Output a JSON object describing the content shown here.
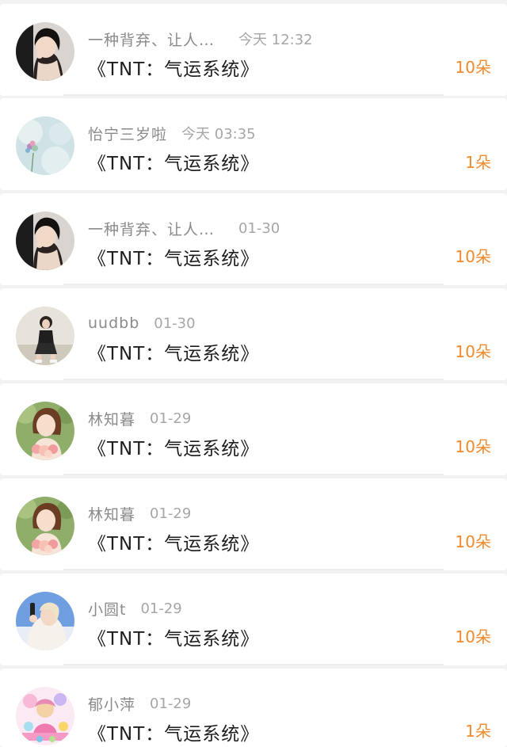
{
  "gifts": [
    {
      "name": "一种背弃、让人…",
      "time": "今天 12:32",
      "book": "《TNT：气运系统》",
      "count": "10朵",
      "avatar_icon": "girl-dark-hair-avatar"
    },
    {
      "name": "怡宁三岁啦",
      "time": "今天 03:35",
      "book": "《TNT：气运系统》",
      "count": "1朵",
      "avatar_icon": "flower-sky-avatar"
    },
    {
      "name": "一种背弃、让人…",
      "time": "01-30",
      "book": "《TNT：气运系统》",
      "count": "10朵",
      "avatar_icon": "girl-dark-hair-avatar"
    },
    {
      "name": "uudbb",
      "time": "01-30",
      "book": "《TNT：气运系统》",
      "count": "10朵",
      "avatar_icon": "sitting-girl-avatar"
    },
    {
      "name": "林知暮",
      "time": "01-29",
      "book": "《TNT：气运系统》",
      "count": "10朵",
      "avatar_icon": "girl-flowers-avatar"
    },
    {
      "name": "林知暮",
      "time": "01-29",
      "book": "《TNT：气运系统》",
      "count": "10朵",
      "avatar_icon": "girl-flowers-avatar"
    },
    {
      "name": "小圆t",
      "time": "01-29",
      "book": "《TNT：气运系统》",
      "count": "10朵",
      "avatar_icon": "girl-blue-sky-avatar"
    },
    {
      "name": "郁小萍",
      "time": "01-29",
      "book": "《TNT：气运系统》",
      "count": "1朵",
      "avatar_icon": "anime-character-avatar"
    }
  ],
  "colors": {
    "count": "#f08a2c",
    "title": "#1e1e1e",
    "name": "#8a8a8a",
    "time": "#a6a6a6",
    "background": "#f2f2f2"
  }
}
